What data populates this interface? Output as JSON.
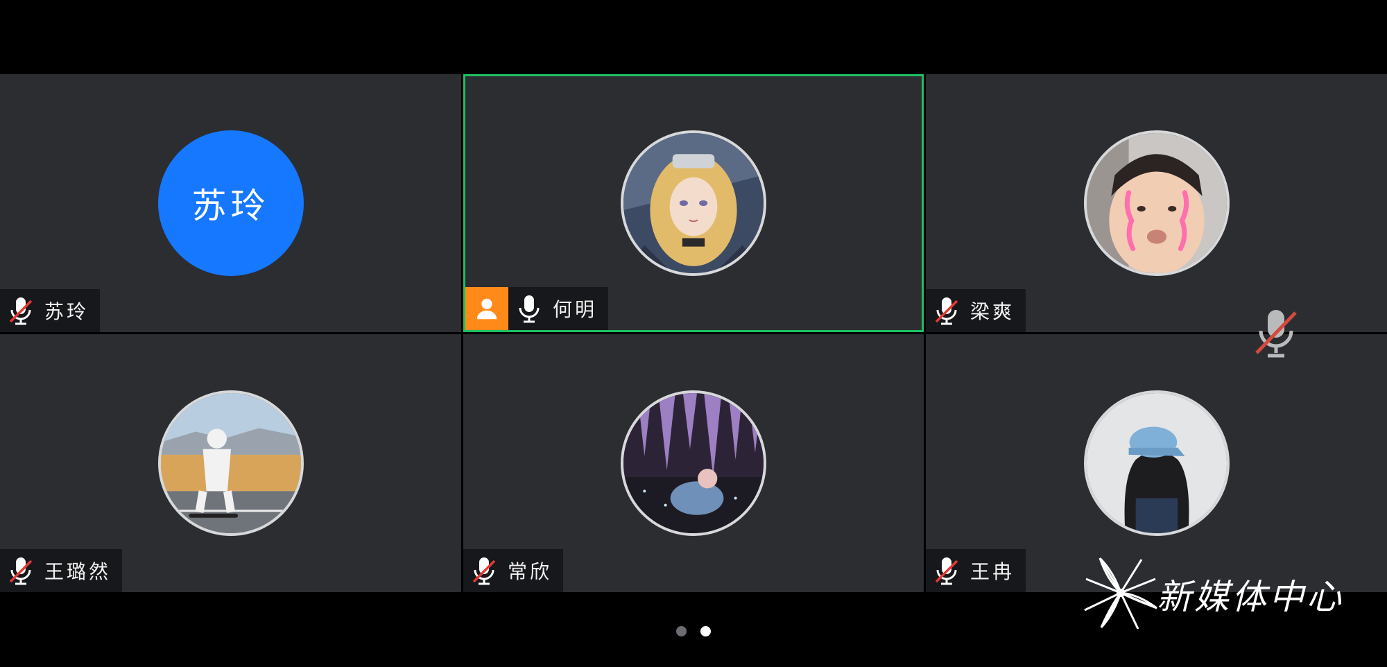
{
  "participants": [
    {
      "name": "苏玲",
      "avatar_text": "苏玲",
      "avatar": "text-avatar",
      "mic": "muted",
      "active": false
    },
    {
      "name": "何明",
      "avatar": "anime-girl-avatar",
      "mic": "on",
      "host": true,
      "active": true
    },
    {
      "name": "梁爽",
      "avatar": "boy-photo-avatar",
      "mic": "muted",
      "active": false
    },
    {
      "name": "王璐然",
      "avatar": "astronaut-photo-avatar",
      "mic": "muted",
      "active": false
    },
    {
      "name": "常欣",
      "avatar": "wisteria-photo-avatar",
      "mic": "muted",
      "active": false
    },
    {
      "name": "王冉",
      "avatar": "girl-cap-photo-avatar",
      "mic": "muted",
      "active": false
    }
  ],
  "self_mic": {
    "state": "muted",
    "icon": "mic-muted-icon"
  },
  "pager": {
    "pages": 2,
    "current": 2
  },
  "watermark": {
    "text": "新媒体中心"
  },
  "colors": {
    "background": "#000000",
    "tile": "#2b2d31",
    "active_border": "#1fbf62",
    "text_avatar": "#1677ff",
    "host_badge": "#ff8a1a",
    "muted_slash": "#e53935"
  }
}
